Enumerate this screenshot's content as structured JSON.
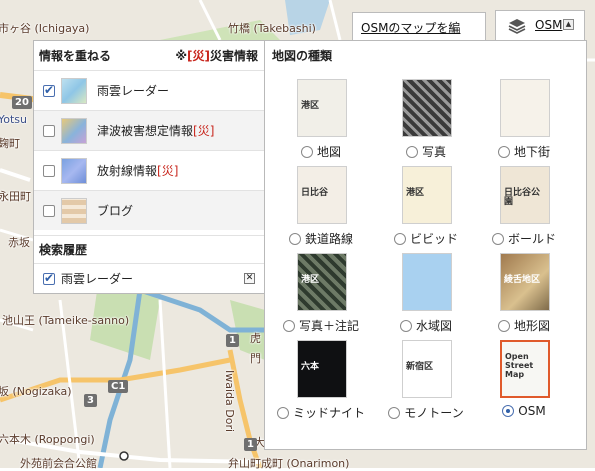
{
  "map": {
    "labels": [
      "市ヶ谷 (Ichigaya)",
      "竹橋 (Takebashi)",
      "Yotsu",
      "麹町",
      "永田町",
      "赤坂",
      "池山王 (Tameike-sanno)",
      "坂 (Nogizaka)",
      "六本木 (Roppongi)",
      "外苑前会合公館",
      "弁山町成町 (Onarimon)",
      "Iwaida Dori",
      "虎",
      "門",
      "大"
    ],
    "shields": [
      "20",
      "1",
      "1",
      "C1",
      "3"
    ]
  },
  "top_bar": {
    "osm_link": "OSMのマップを編",
    "layer_button_label": "OSM",
    "layer_icon": "layers-icon",
    "caret_icon": "caret-up-icon"
  },
  "overlay_panel": {
    "title": "情報を重ねる",
    "note_prefix": "※",
    "note_tag": "[災]",
    "note_suffix": "災害情報",
    "items": [
      {
        "label": "雨雲レーダー",
        "tag": "",
        "checked": true
      },
      {
        "label": "津波被害想定情報",
        "tag": "[災]",
        "checked": false
      },
      {
        "label": "放射線情報",
        "tag": "[災]",
        "checked": false
      },
      {
        "label": "ブログ",
        "tag": "",
        "checked": false
      }
    ],
    "history_title": "検索履歴",
    "history_items": [
      {
        "label": "雨雲レーダー",
        "checked": true
      }
    ]
  },
  "maptype_panel": {
    "title": "地図の種類",
    "selected": "OSM",
    "types": [
      {
        "label": "地図",
        "thumb_text": "港区"
      },
      {
        "label": "写真",
        "thumb_text": ""
      },
      {
        "label": "地下街",
        "thumb_text": ""
      },
      {
        "label": "鉄道路線",
        "thumb_text": "日比谷"
      },
      {
        "label": "ビビッド",
        "thumb_text": "港区"
      },
      {
        "label": "ボールド",
        "thumb_text": "日比谷公園"
      },
      {
        "label": "写真＋注記",
        "thumb_text": "港区"
      },
      {
        "label": "水域図",
        "thumb_text": ""
      },
      {
        "label": "地形図",
        "thumb_text": "綾舌地区"
      },
      {
        "label": "ミッドナイト",
        "thumb_text": "六本"
      },
      {
        "label": "モノトーン",
        "thumb_text": "新宿区"
      },
      {
        "label": "OSM",
        "thumb_text": "Open Street Map"
      }
    ]
  }
}
